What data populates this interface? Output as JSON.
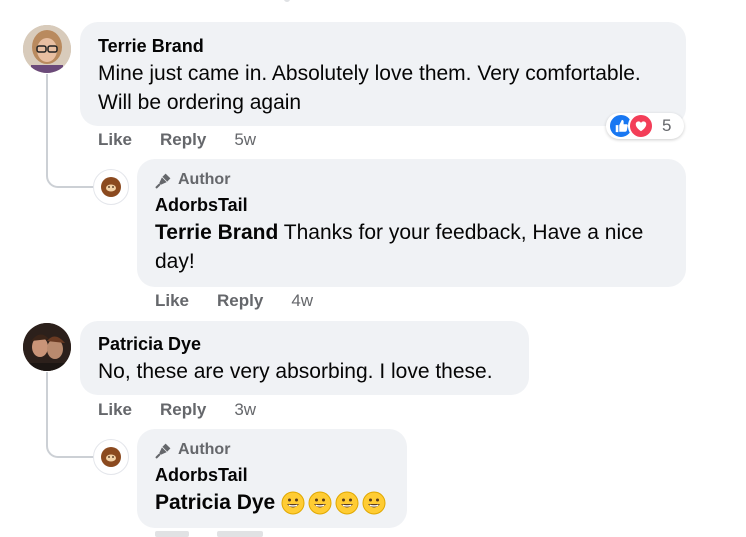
{
  "comments": [
    {
      "author": "Terrie Brand",
      "text": "Mine just came in. Absolutely love them. Very comfortable. Will be ordering again",
      "actions": {
        "like": "Like",
        "reply": "Reply",
        "time": "5w"
      },
      "reactions": {
        "count": "5",
        "icons": [
          "like-icon",
          "love-icon"
        ],
        "colors": {
          "like": "#1877f2",
          "love": "#f33e58"
        }
      },
      "reply": {
        "badge": "Author",
        "author": "AdorbsTail",
        "mention": "Terrie Brand",
        "text": "Thanks for your feedback, Have a nice day!",
        "actions": {
          "like": "Like",
          "reply": "Reply",
          "time": "4w"
        }
      }
    },
    {
      "author": "Patricia Dye",
      "text": "No, these are very absorbing. I love these.",
      "actions": {
        "like": "Like",
        "reply": "Reply",
        "time": "3w"
      },
      "reply": {
        "badge": "Author",
        "author": "AdorbsTail",
        "mention": "Patricia Dye",
        "emojis": [
          "grinning-face-icon",
          "grinning-face-icon",
          "grinning-face-icon",
          "grinning-face-icon"
        ]
      }
    }
  ],
  "colors": {
    "bubble": "#f0f2f5",
    "secondary_text": "#65676b",
    "brand_avatar": "#8b4a1f"
  }
}
